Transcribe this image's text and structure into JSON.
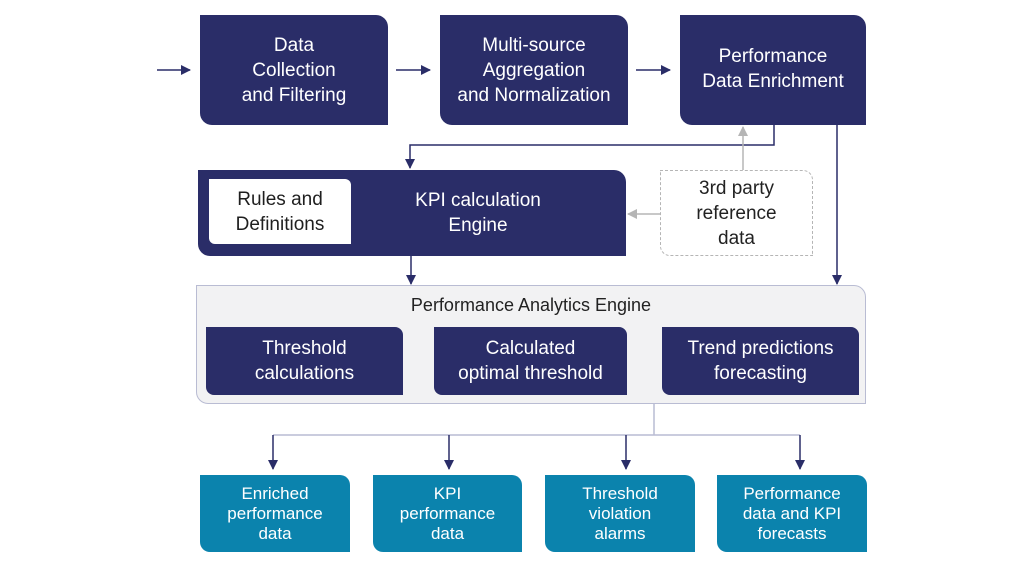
{
  "diagram": {
    "pipeline": [
      {
        "id": "data-collection",
        "label": "Data\nCollection\nand Filtering"
      },
      {
        "id": "aggregation",
        "label": "Multi-source\nAggregation\nand Normalization"
      },
      {
        "id": "enrichment",
        "label": "Performance\nData Enrichment"
      }
    ],
    "kpi_engine": {
      "label": "KPI calculation\nEngine",
      "rules_label": "Rules and\nDefinitions"
    },
    "third_party": {
      "label": "3rd  party\nreference\ndata"
    },
    "analytics_engine": {
      "title": "Performance Analytics Engine",
      "modules": [
        {
          "label": "Threshold\ncalculations"
        },
        {
          "label": "Calculated\noptimal threshold"
        },
        {
          "label": "Trend predictions\nforecasting"
        }
      ]
    },
    "outputs": [
      {
        "label": "Enriched\nperformance\ndata"
      },
      {
        "label": "KPI\nperformance\ndata"
      },
      {
        "label": "Threshold\nviolation\nalarms"
      },
      {
        "label": "Performance\ndata and KPI\nforecasts"
      }
    ],
    "colors": {
      "navy": "#2a2d68",
      "teal": "#0b83ad",
      "connector": "#2a2d68",
      "reference_connector": "#b5b5b5",
      "panel": "#f2f2f3"
    }
  }
}
